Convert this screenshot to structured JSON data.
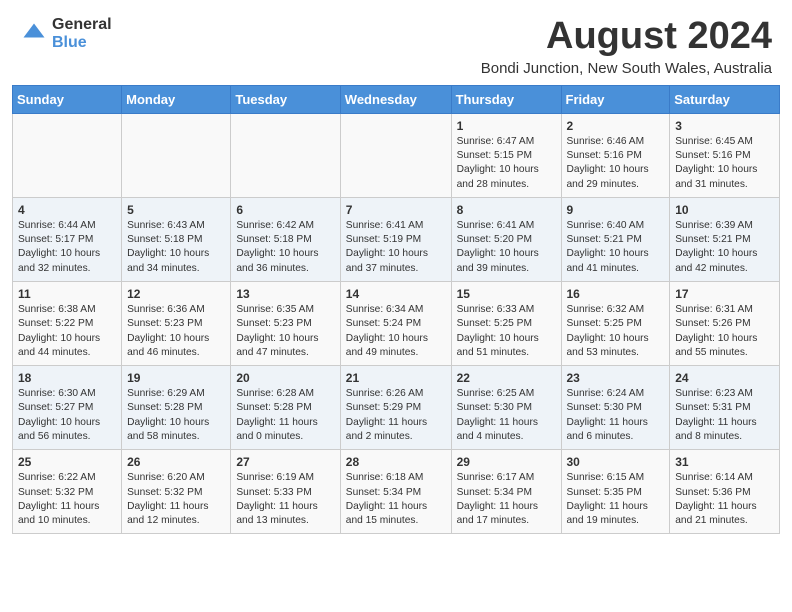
{
  "logo": {
    "general": "General",
    "blue": "Blue"
  },
  "header": {
    "title": "August 2024",
    "subtitle": "Bondi Junction, New South Wales, Australia"
  },
  "weekdays": [
    "Sunday",
    "Monday",
    "Tuesday",
    "Wednesday",
    "Thursday",
    "Friday",
    "Saturday"
  ],
  "weeks": [
    [
      {
        "day": "",
        "content": ""
      },
      {
        "day": "",
        "content": ""
      },
      {
        "day": "",
        "content": ""
      },
      {
        "day": "",
        "content": ""
      },
      {
        "day": "1",
        "content": "Sunrise: 6:47 AM\nSunset: 5:15 PM\nDaylight: 10 hours\nand 28 minutes."
      },
      {
        "day": "2",
        "content": "Sunrise: 6:46 AM\nSunset: 5:16 PM\nDaylight: 10 hours\nand 29 minutes."
      },
      {
        "day": "3",
        "content": "Sunrise: 6:45 AM\nSunset: 5:16 PM\nDaylight: 10 hours\nand 31 minutes."
      }
    ],
    [
      {
        "day": "4",
        "content": "Sunrise: 6:44 AM\nSunset: 5:17 PM\nDaylight: 10 hours\nand 32 minutes."
      },
      {
        "day": "5",
        "content": "Sunrise: 6:43 AM\nSunset: 5:18 PM\nDaylight: 10 hours\nand 34 minutes."
      },
      {
        "day": "6",
        "content": "Sunrise: 6:42 AM\nSunset: 5:18 PM\nDaylight: 10 hours\nand 36 minutes."
      },
      {
        "day": "7",
        "content": "Sunrise: 6:41 AM\nSunset: 5:19 PM\nDaylight: 10 hours\nand 37 minutes."
      },
      {
        "day": "8",
        "content": "Sunrise: 6:41 AM\nSunset: 5:20 PM\nDaylight: 10 hours\nand 39 minutes."
      },
      {
        "day": "9",
        "content": "Sunrise: 6:40 AM\nSunset: 5:21 PM\nDaylight: 10 hours\nand 41 minutes."
      },
      {
        "day": "10",
        "content": "Sunrise: 6:39 AM\nSunset: 5:21 PM\nDaylight: 10 hours\nand 42 minutes."
      }
    ],
    [
      {
        "day": "11",
        "content": "Sunrise: 6:38 AM\nSunset: 5:22 PM\nDaylight: 10 hours\nand 44 minutes."
      },
      {
        "day": "12",
        "content": "Sunrise: 6:36 AM\nSunset: 5:23 PM\nDaylight: 10 hours\nand 46 minutes."
      },
      {
        "day": "13",
        "content": "Sunrise: 6:35 AM\nSunset: 5:23 PM\nDaylight: 10 hours\nand 47 minutes."
      },
      {
        "day": "14",
        "content": "Sunrise: 6:34 AM\nSunset: 5:24 PM\nDaylight: 10 hours\nand 49 minutes."
      },
      {
        "day": "15",
        "content": "Sunrise: 6:33 AM\nSunset: 5:25 PM\nDaylight: 10 hours\nand 51 minutes."
      },
      {
        "day": "16",
        "content": "Sunrise: 6:32 AM\nSunset: 5:25 PM\nDaylight: 10 hours\nand 53 minutes."
      },
      {
        "day": "17",
        "content": "Sunrise: 6:31 AM\nSunset: 5:26 PM\nDaylight: 10 hours\nand 55 minutes."
      }
    ],
    [
      {
        "day": "18",
        "content": "Sunrise: 6:30 AM\nSunset: 5:27 PM\nDaylight: 10 hours\nand 56 minutes."
      },
      {
        "day": "19",
        "content": "Sunrise: 6:29 AM\nSunset: 5:28 PM\nDaylight: 10 hours\nand 58 minutes."
      },
      {
        "day": "20",
        "content": "Sunrise: 6:28 AM\nSunset: 5:28 PM\nDaylight: 11 hours\nand 0 minutes."
      },
      {
        "day": "21",
        "content": "Sunrise: 6:26 AM\nSunset: 5:29 PM\nDaylight: 11 hours\nand 2 minutes."
      },
      {
        "day": "22",
        "content": "Sunrise: 6:25 AM\nSunset: 5:30 PM\nDaylight: 11 hours\nand 4 minutes."
      },
      {
        "day": "23",
        "content": "Sunrise: 6:24 AM\nSunset: 5:30 PM\nDaylight: 11 hours\nand 6 minutes."
      },
      {
        "day": "24",
        "content": "Sunrise: 6:23 AM\nSunset: 5:31 PM\nDaylight: 11 hours\nand 8 minutes."
      }
    ],
    [
      {
        "day": "25",
        "content": "Sunrise: 6:22 AM\nSunset: 5:32 PM\nDaylight: 11 hours\nand 10 minutes."
      },
      {
        "day": "26",
        "content": "Sunrise: 6:20 AM\nSunset: 5:32 PM\nDaylight: 11 hours\nand 12 minutes."
      },
      {
        "day": "27",
        "content": "Sunrise: 6:19 AM\nSunset: 5:33 PM\nDaylight: 11 hours\nand 13 minutes."
      },
      {
        "day": "28",
        "content": "Sunrise: 6:18 AM\nSunset: 5:34 PM\nDaylight: 11 hours\nand 15 minutes."
      },
      {
        "day": "29",
        "content": "Sunrise: 6:17 AM\nSunset: 5:34 PM\nDaylight: 11 hours\nand 17 minutes."
      },
      {
        "day": "30",
        "content": "Sunrise: 6:15 AM\nSunset: 5:35 PM\nDaylight: 11 hours\nand 19 minutes."
      },
      {
        "day": "31",
        "content": "Sunrise: 6:14 AM\nSunset: 5:36 PM\nDaylight: 11 hours\nand 21 minutes."
      }
    ]
  ]
}
